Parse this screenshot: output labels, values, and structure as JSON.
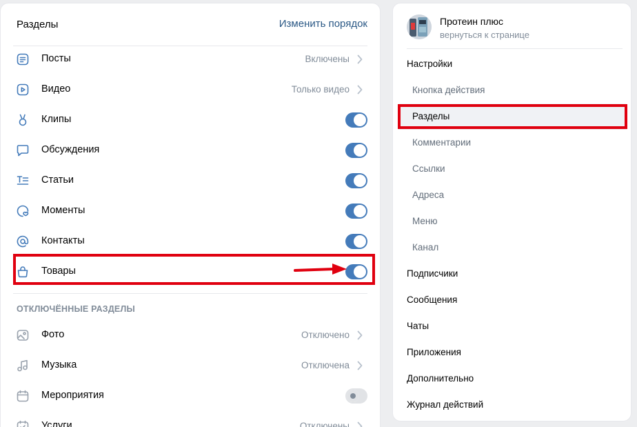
{
  "sections_card": {
    "title": "Разделы",
    "reorder_link": "Изменить порядок",
    "active_sections": [
      {
        "label": "Посты",
        "value": "Включены",
        "control": "chevron",
        "icon": "posts-icon"
      },
      {
        "label": "Видео",
        "value": "Только видео",
        "control": "chevron",
        "icon": "video-icon"
      },
      {
        "label": "Клипы",
        "control": "toggle",
        "enabled": true,
        "icon": "clips-icon"
      },
      {
        "label": "Обсуждения",
        "control": "toggle",
        "enabled": true,
        "icon": "discussions-icon"
      },
      {
        "label": "Статьи",
        "control": "toggle",
        "enabled": true,
        "icon": "articles-icon"
      },
      {
        "label": "Моменты",
        "control": "toggle",
        "enabled": true,
        "icon": "moments-icon"
      },
      {
        "label": "Контакты",
        "control": "toggle",
        "enabled": true,
        "icon": "contacts-icon"
      },
      {
        "label": "Товары",
        "control": "toggle",
        "enabled": true,
        "icon": "market-icon",
        "highlighted": true
      }
    ],
    "disabled_title": "ОТКЛЮЧЁННЫЕ РАЗДЕЛЫ",
    "disabled_sections": [
      {
        "label": "Фото",
        "value": "Отключено",
        "control": "chevron",
        "icon": "photo-icon"
      },
      {
        "label": "Музыка",
        "value": "Отключена",
        "control": "chevron",
        "icon": "music-icon"
      },
      {
        "label": "Мероприятия",
        "control": "toggle",
        "enabled": false,
        "icon": "events-icon"
      },
      {
        "label": "Услуги",
        "value": "Отключены",
        "control": "chevron",
        "icon": "services-icon"
      }
    ]
  },
  "sidebar": {
    "group_name": "Протеин плюс",
    "back_link": "вернуться к странице",
    "menu": [
      {
        "label": "Настройки",
        "level": "top"
      },
      {
        "label": "Кнопка действия",
        "level": "sub"
      },
      {
        "label": "Разделы",
        "level": "sub",
        "active": true
      },
      {
        "label": "Комментарии",
        "level": "sub"
      },
      {
        "label": "Ссылки",
        "level": "sub"
      },
      {
        "label": "Адреса",
        "level": "sub"
      },
      {
        "label": "Меню",
        "level": "sub"
      },
      {
        "label": "Канал",
        "level": "sub"
      },
      {
        "label": "Подписчики",
        "level": "top"
      },
      {
        "label": "Сообщения",
        "level": "top"
      },
      {
        "label": "Чаты",
        "level": "top"
      },
      {
        "label": "Приложения",
        "level": "top"
      },
      {
        "label": "Дополнительно",
        "level": "top"
      },
      {
        "label": "Журнал действий",
        "level": "top"
      }
    ]
  },
  "colors": {
    "accent": "#447bba",
    "link": "#2a5885",
    "highlight": "#e0000f",
    "secondary_text": "#818c99"
  }
}
